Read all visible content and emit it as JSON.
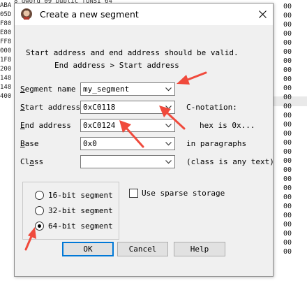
{
  "background": {
    "left_rows": [
      "ABA",
      "05D",
      "F80",
      "E80",
      "FF8",
      "000",
      "1F8",
      "200",
      "148",
      "148",
      "400"
    ],
    "top_strip": "8        dword   09   public [UNSI   64",
    "right_values": [
      "00",
      "00",
      "00",
      "00",
      "00",
      "00",
      "00",
      "00",
      "00",
      "00",
      "00",
      "00",
      "00",
      "00",
      "00",
      "00",
      "00",
      "00",
      "00",
      "00",
      "00",
      "00",
      "00",
      "00",
      "00",
      "00",
      "00",
      "00"
    ]
  },
  "dialog": {
    "title": "Create a new segment",
    "info_line1": "Start address and end address should be valid.",
    "info_line2": "End address > Start address",
    "fields": {
      "segment_name": {
        "label_underlined": "S",
        "label_rest": "egment name",
        "value": "my_segment"
      },
      "start_address": {
        "label_underlined": "S",
        "label_rest": "tart address",
        "value": "0xC0118"
      },
      "end_address": {
        "label_underlined": "E",
        "label_rest": "nd address",
        "value": "0xC0124"
      },
      "base": {
        "label_underlined": "B",
        "label_rest": "ase",
        "value": "0x0"
      },
      "class": {
        "label_prefix": "Cl",
        "label_underlined": "a",
        "label_rest": "ss",
        "value": ""
      }
    },
    "notes": {
      "c_notation": "C-notation:",
      "hex_is": "hex is 0x...",
      "in_paragraphs": "in paragraphs",
      "class_any_text": "(class is any text)"
    },
    "bitness": {
      "options": [
        "16-bit segment",
        "32-bit segment",
        "64-bit segment"
      ],
      "selected": "64-bit segment"
    },
    "sparse_storage": {
      "label": "Use sparse storage",
      "checked": false
    },
    "buttons": {
      "ok": "OK",
      "cancel": "Cancel",
      "help": "Help"
    }
  },
  "colors": {
    "annotation_arrow": "#f04a3c",
    "default_button_border": "#0078d7"
  }
}
